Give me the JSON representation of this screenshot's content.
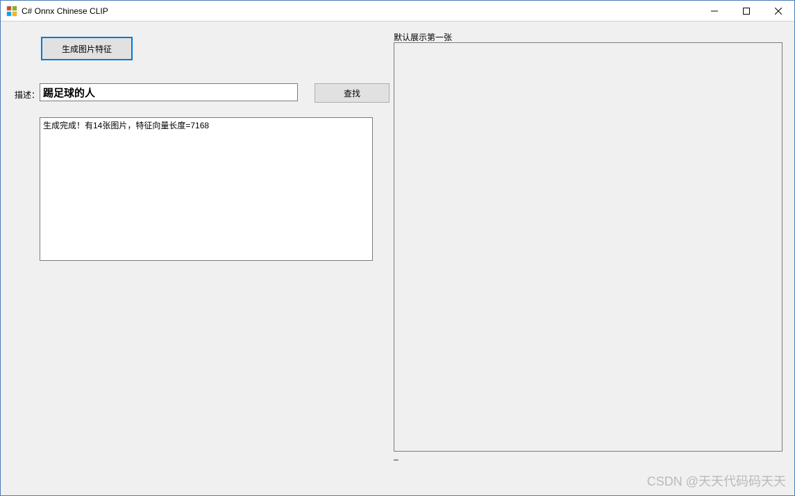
{
  "window": {
    "title": "C# Onnx Chinese CLIP"
  },
  "buttons": {
    "generate": "生成图片特征",
    "search": "查找"
  },
  "labels": {
    "description": "描述：",
    "preview": "默认展示第一张",
    "dash": "–"
  },
  "inputs": {
    "description_value": "踢足球的人"
  },
  "log": {
    "text": "生成完成！有14张图片，特征向量长度=7168"
  },
  "watermark": "CSDN @天天代码码天天"
}
